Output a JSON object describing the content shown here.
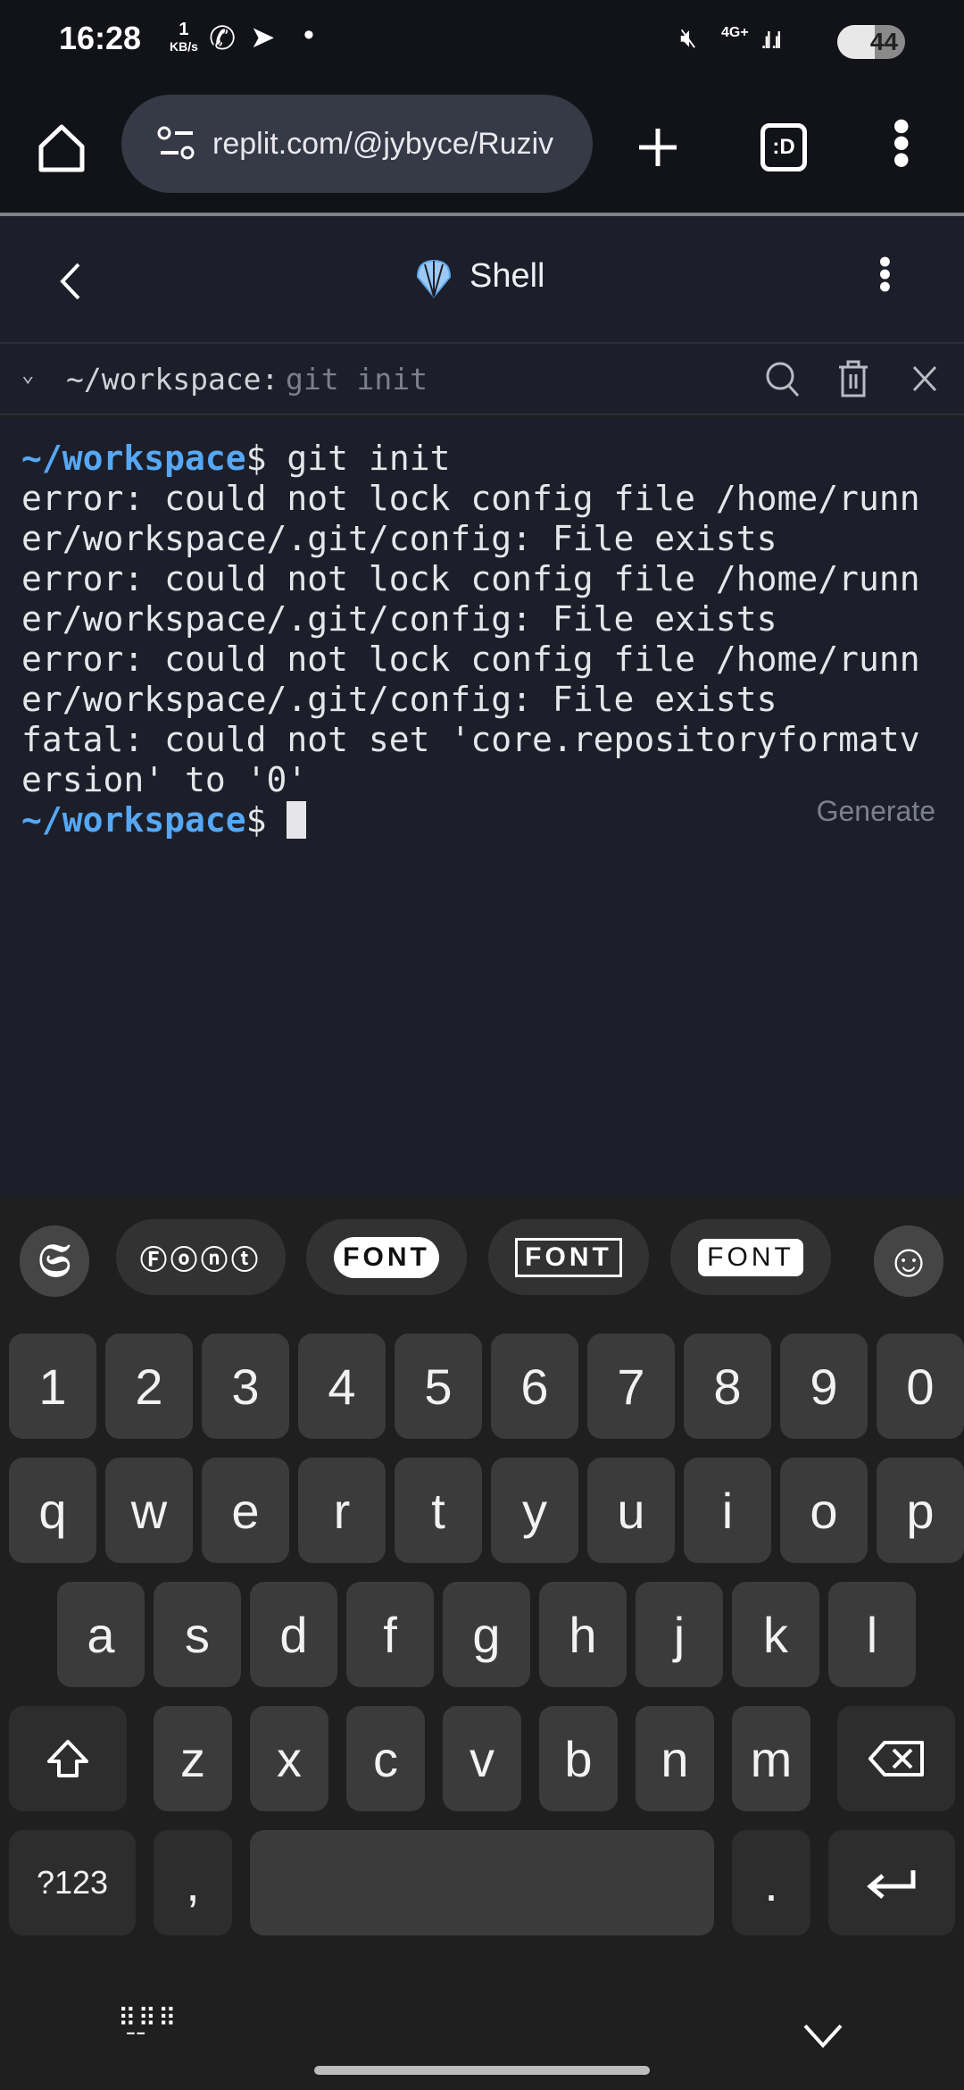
{
  "status": {
    "time": "16:28",
    "net_speed_value": "1",
    "net_speed_unit": "KB/s",
    "battery": "44",
    "network": "4G+"
  },
  "browser": {
    "url": "replit.com/@jybyce/Ruziv",
    "tab_badge": ":D"
  },
  "shell": {
    "title": "Shell"
  },
  "tab": {
    "path": "~/workspace:",
    "command": "git init"
  },
  "terminal": {
    "prompt": "~/workspace",
    "first_cmd": "$ git init",
    "lines": [
      "error: could not lock config file /home/runn",
      "er/workspace/.git/config: File exists",
      "error: could not lock config file /home/runn",
      "er/workspace/.git/config: File exists",
      "error: could not lock config file /home/runn",
      "er/workspace/.git/config: File exists",
      "fatal: could not set 'core.repositoryformatv",
      "ersion' to '0'"
    ],
    "prompt_suffix": "$ ",
    "generate_label": "Generate"
  },
  "keyboard": {
    "suggestions": [
      "Ⓕⓞⓝⓣ",
      "FONT",
      "FONT",
      "FONT"
    ],
    "rows": [
      [
        "1",
        "2",
        "3",
        "4",
        "5",
        "6",
        "7",
        "8",
        "9",
        "0"
      ],
      [
        "q",
        "w",
        "e",
        "r",
        "t",
        "y",
        "u",
        "i",
        "o",
        "p"
      ],
      [
        "a",
        "s",
        "d",
        "f",
        "g",
        "h",
        "j",
        "k",
        "l"
      ],
      [
        "z",
        "x",
        "c",
        "v",
        "b",
        "n",
        "m"
      ]
    ],
    "symbols_label": "?123",
    "comma": ",",
    "period": "."
  },
  "colors": {
    "terminal_bg": "#1c1f2a",
    "prompt": "#56a8f5",
    "key": "#3b3b3b",
    "keyboard_bg": "#1f1f1f"
  }
}
